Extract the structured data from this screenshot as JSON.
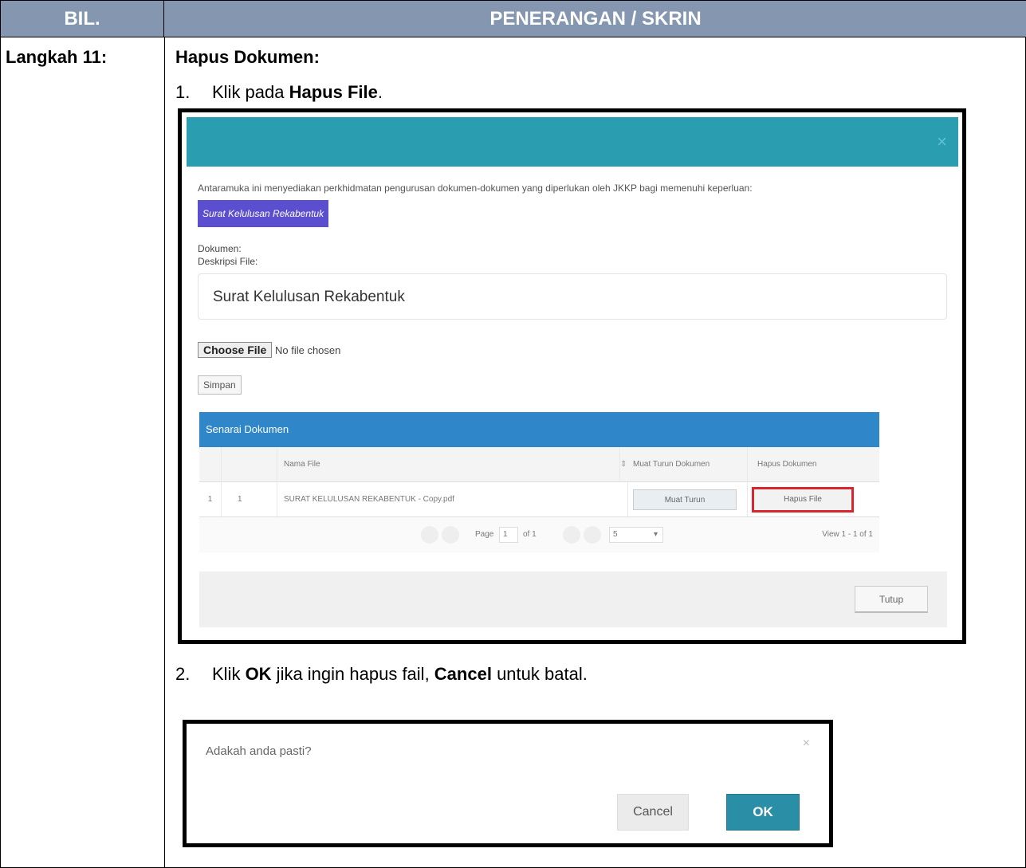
{
  "header": {
    "bil": "BIL.",
    "penerangan": "PENERANGAN / SKRIN"
  },
  "step": {
    "label": "Langkah 11:",
    "title": "Hapus Dokumen:"
  },
  "instruction1": {
    "num": "1.",
    "pre": "Klik pada ",
    "bold": "Hapus File",
    "post": "."
  },
  "instruction2": {
    "num": "2.",
    "pre": "Klik ",
    "bold1": "OK",
    "mid": " jika ingin hapus fail, ",
    "bold2": "Cancel",
    "post": " untuk batal."
  },
  "modal": {
    "close": "×",
    "intro": "Antaramuka ini menyediakan perkhidmatan pengurusan dokumen-dokumen yang diperlukan oleh JKKP bagi memenuhi keperluan:",
    "tag": "Surat Kelulusan Rekabentuk",
    "dokumen_label": "Dokumen:",
    "deskripsi_label": "Deskripsi File:",
    "deskripsi_value": "Surat Kelulusan Rekabentuk",
    "choose_file": "Choose File",
    "no_file": "No file chosen",
    "simpan": "Simpan",
    "grid": {
      "caption": "Senarai Dokumen",
      "columns": [
        "Nama File",
        "Muat Turun Dokumen",
        "Hapus Dokumen"
      ],
      "sort_icon": "⇕",
      "row": {
        "idx": "1",
        "no": "1",
        "name": "SURAT KELULUSAN REKABENTUK - Copy.pdf",
        "download": "Muat Turun",
        "delete": "Hapus File"
      },
      "pager": {
        "page_label": "Page",
        "page": "1",
        "of": "of 1",
        "per_page": "5",
        "view": "View 1 - 1 of 1"
      }
    },
    "tutup": "Tutup"
  },
  "dialog": {
    "message": "Adakah anda pasti?",
    "close": "×",
    "cancel": "Cancel",
    "ok": "OK"
  }
}
